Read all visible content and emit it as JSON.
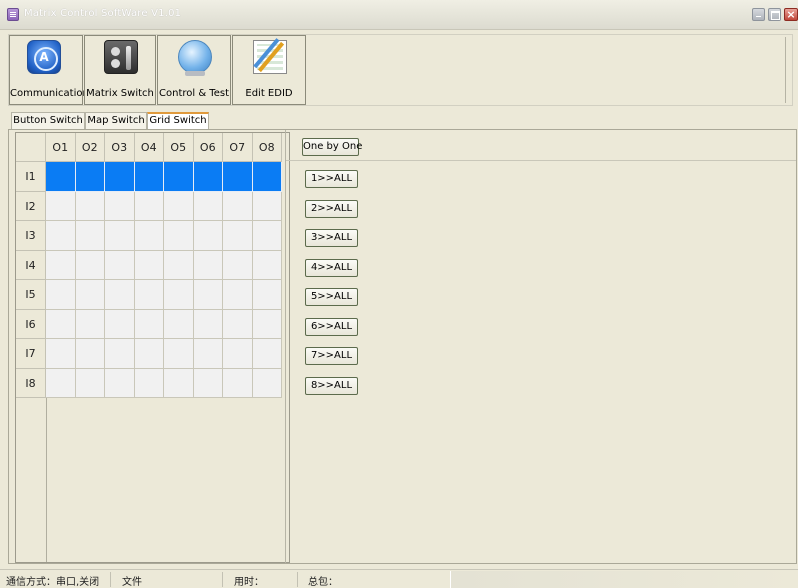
{
  "window": {
    "title": "Matrix Control SoftWare V1.01"
  },
  "toolbar": {
    "buttons": [
      {
        "label": "Communication",
        "icon": "communication-icon"
      },
      {
        "label": "Matrix Switch",
        "icon": "matrix-switch-icon"
      },
      {
        "label": "Control & Test",
        "icon": "control-test-icon"
      },
      {
        "label": "Edit EDID",
        "icon": "edit-edid-icon"
      }
    ]
  },
  "tabs": [
    {
      "label": "Button Switch",
      "active": false
    },
    {
      "label": "Map Switch",
      "active": false
    },
    {
      "label": "Grid Switch",
      "active": true
    }
  ],
  "grid": {
    "outputs": [
      "O1",
      "O2",
      "O3",
      "O4",
      "O5",
      "O6",
      "O7",
      "O8"
    ],
    "inputs": [
      "I1",
      "I2",
      "I3",
      "I4",
      "I5",
      "I6",
      "I7",
      "I8"
    ],
    "active_input_index": 0,
    "active_color": "#0a7cf4"
  },
  "actions": {
    "one_by_one_label": "One by One",
    "all_labels": [
      "1>>ALL",
      "2>>ALL",
      "3>>ALL",
      "4>>ALL",
      "5>>ALL",
      "6>>ALL",
      "7>>ALL",
      "8>>ALL"
    ]
  },
  "statusbar": {
    "connection": "通信方式：串口,关闭",
    "file": "文件",
    "time": "用时：",
    "total": "总包："
  }
}
